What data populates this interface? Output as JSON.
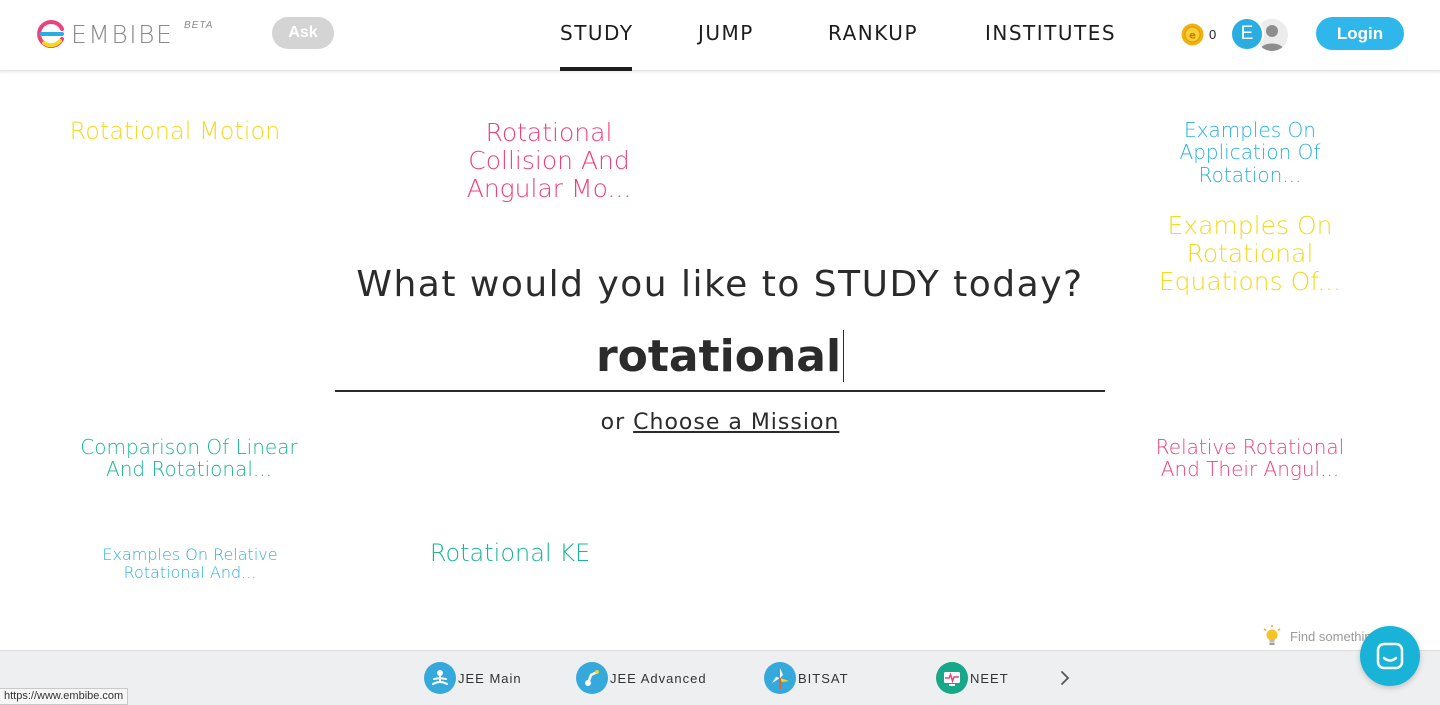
{
  "header": {
    "logo_text": "EMBIBE",
    "logo_badge": "BETA",
    "ask_label": "Ask",
    "nav": [
      {
        "label": "STUDY",
        "active": true
      },
      {
        "label": "JUMP",
        "active": false
      },
      {
        "label": "RANKUP",
        "active": false
      },
      {
        "label": "INSTITUTES",
        "active": false
      }
    ],
    "coin_count": "0",
    "avatar_initial": "E",
    "login_label": "Login"
  },
  "suggestions": [
    {
      "text": "Rotational Motion",
      "color": "#f6d81c"
    },
    {
      "text": "Rotational Collision And Angular Mo...",
      "color": "#ef3f7c"
    },
    {
      "text": "Examples On Application Of Rotation...",
      "color": "#27aee3"
    },
    {
      "text": "Examples On Rotational Equations Of...",
      "color": "#f6d81c"
    },
    {
      "text": "Comparison Of Linear And Rotational...",
      "color": "#17b597"
    },
    {
      "text": "Relative Rotational And Their Angul...",
      "color": "#ef3f7c"
    },
    {
      "text": "Examples On Relative Rotational And...",
      "color": "#27aee3"
    },
    {
      "text": "Rotational KE",
      "color": "#17b597"
    }
  ],
  "search": {
    "prompt": "What would you like to STUDY today?",
    "value": "rotational",
    "or_text": "or",
    "mission_link": "Choose a Mission"
  },
  "hint": {
    "text": "Find something cool"
  },
  "exams": [
    {
      "label": "JEE Main",
      "icon": "meditating-person-icon"
    },
    {
      "label": "JEE Advanced",
      "icon": "robot-arm-icon"
    },
    {
      "label": "BITSAT",
      "icon": "windmill-icon"
    },
    {
      "label": "NEET",
      "icon": "ecg-monitor-icon"
    }
  ],
  "status_url": "https://www.embibe.com"
}
